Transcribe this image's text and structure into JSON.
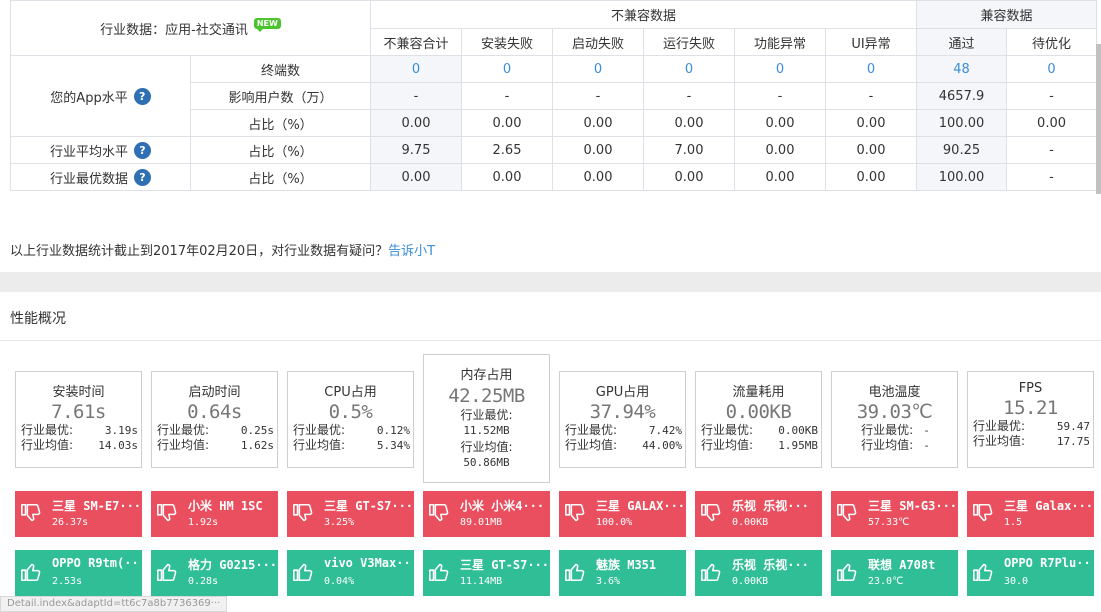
{
  "table": {
    "title_prefix": "行业数据：应用-社交通讯",
    "new_badge": "NEW",
    "group_incompatible": "不兼容数据",
    "group_compatible": "兼容数据",
    "columns": [
      "不兼容合计",
      "安装失败",
      "启动失败",
      "运行失败",
      "功能异常",
      "UI异常",
      "通过",
      "待优化"
    ],
    "your_level": "您的App水平",
    "industry_avg": "行业平均水平",
    "industry_best": "行业最优数据",
    "help_glyph": "?",
    "rows": [
      {
        "label": "终端数",
        "cells": [
          "0",
          "0",
          "0",
          "0",
          "0",
          "0",
          "48",
          "0"
        ]
      },
      {
        "label": "影响用户数（万）",
        "cells": [
          "-",
          "-",
          "-",
          "-",
          "-",
          "-",
          "4657.9",
          "-"
        ]
      },
      {
        "label": "占比（%）",
        "cells": [
          "0.00",
          "0.00",
          "0.00",
          "0.00",
          "0.00",
          "0.00",
          "100.00",
          "0.00"
        ]
      },
      {
        "label": "占比（%）",
        "cells": [
          "9.75",
          "2.65",
          "0.00",
          "7.00",
          "0.00",
          "0.00",
          "90.25",
          "-"
        ]
      },
      {
        "label": "占比（%）",
        "cells": [
          "0.00",
          "0.00",
          "0.00",
          "0.00",
          "0.00",
          "0.00",
          "100.00",
          "-"
        ]
      }
    ]
  },
  "note": {
    "text": "以上行业数据统计截止到2017年02月20日，对行业数据有疑问？",
    "link": "告诉小T"
  },
  "perf": {
    "title": "性能概况",
    "metrics": [
      {
        "name": "安装时间",
        "value": "7.61s",
        "best_label": "行业最优:",
        "best": "3.19s",
        "avg_label": "行业均值:",
        "avg": "14.03s"
      },
      {
        "name": "启动时间",
        "value": "0.64s",
        "best_label": "行业最优:",
        "best": "0.25s",
        "avg_label": "行业均值:",
        "avg": "1.62s"
      },
      {
        "name": "CPU占用",
        "value": "0.5%",
        "best_label": "行业最优:",
        "best": "0.12%",
        "avg_label": "行业均值:",
        "avg": "5.34%"
      },
      {
        "name": "内存占用",
        "value": "42.25MB",
        "best_label": "行业最优:",
        "best": "11.52MB",
        "avg_label": "行业均值:",
        "avg": "50.86MB"
      },
      {
        "name": "GPU占用",
        "value": "37.94%",
        "best_label": "行业最优:",
        "best": "7.42%",
        "avg_label": "行业均值:",
        "avg": "44.00%"
      },
      {
        "name": "流量耗用",
        "value": "0.00KB",
        "best_label": "行业最优:",
        "best": "0.00KB",
        "avg_label": "行业均值:",
        "avg": "1.95MB"
      },
      {
        "name": "电池温度",
        "value": "39.03℃",
        "best_label": "行业最优:",
        "best": "-",
        "avg_label": "行业均值:",
        "avg": "-"
      },
      {
        "name": "FPS",
        "value": "15.21",
        "best_label": "行业最优:",
        "best": "59.47",
        "avg_label": "行业均值:",
        "avg": "17.75"
      }
    ],
    "worst": [
      {
        "name": "三星 SM-E7···",
        "value": "26.37s"
      },
      {
        "name": "小米 HM 1SC",
        "value": "1.92s"
      },
      {
        "name": "三星 GT-S7···",
        "value": "3.25%"
      },
      {
        "name": "小米 小米4···",
        "value": "89.01MB"
      },
      {
        "name": "三星 GALAX···",
        "value": "100.0%"
      },
      {
        "name": "乐视 乐视···",
        "value": "0.00KB"
      },
      {
        "name": "三星 SM-G3···",
        "value": "57.33℃"
      },
      {
        "name": "三星 Galax···",
        "value": "1.5"
      }
    ],
    "best": [
      {
        "name": "OPPO R9tm(···",
        "value": "2.53s"
      },
      {
        "name": "格力 G0215···",
        "value": "0.28s"
      },
      {
        "name": "vivo V3Max···",
        "value": "0.04%"
      },
      {
        "name": "三星 GT-S7···",
        "value": "11.14MB"
      },
      {
        "name": "魅族 M351",
        "value": "3.6%"
      },
      {
        "name": "乐视 乐视···",
        "value": "0.00KB"
      },
      {
        "name": "联想 A708t",
        "value": "23.0℃"
      },
      {
        "name": "OPPO R7Plu···",
        "value": "30.0"
      }
    ]
  },
  "status_url": "Detail.index&adaptId=tt6c7a8b7736369···",
  "colors": {
    "bad": "#e94f5e",
    "good": "#2fbe96",
    "link": "#3a8ed8",
    "help": "#2f6fb3"
  },
  "icons": {
    "bad": "thumbs-down-icon",
    "good": "thumbs-up-icon"
  }
}
